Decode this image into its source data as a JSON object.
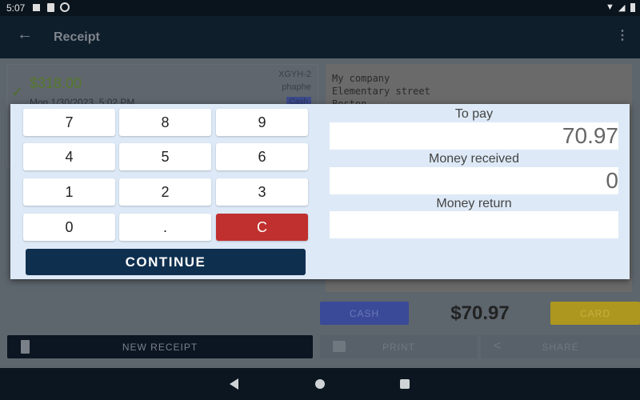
{
  "status": {
    "time": "5:07"
  },
  "toolbar": {
    "title": "Receipt"
  },
  "card": {
    "amount": "$318.00",
    "date": "Mon 1/30/2023, 5:02 PM",
    "code": "XGYH-2",
    "user": "phaphe",
    "badge": "Cash"
  },
  "receipt": {
    "text": "My company\nElementary street\nBoston"
  },
  "actions": {
    "cash": "CASH",
    "total": "$70.97",
    "card": "CARD",
    "new_receipt": "NEW RECEIPT",
    "print": "PRINT",
    "share": "SHARE"
  },
  "dialog": {
    "keys": [
      "7",
      "8",
      "9",
      "4",
      "5",
      "6",
      "1",
      "2",
      "3",
      "0",
      ".",
      "C"
    ],
    "continue": "CONTINUE",
    "to_pay_label": "To pay",
    "to_pay": "70.97",
    "received_label": "Money received",
    "received": "0",
    "return_label": "Money return",
    "return": ""
  }
}
